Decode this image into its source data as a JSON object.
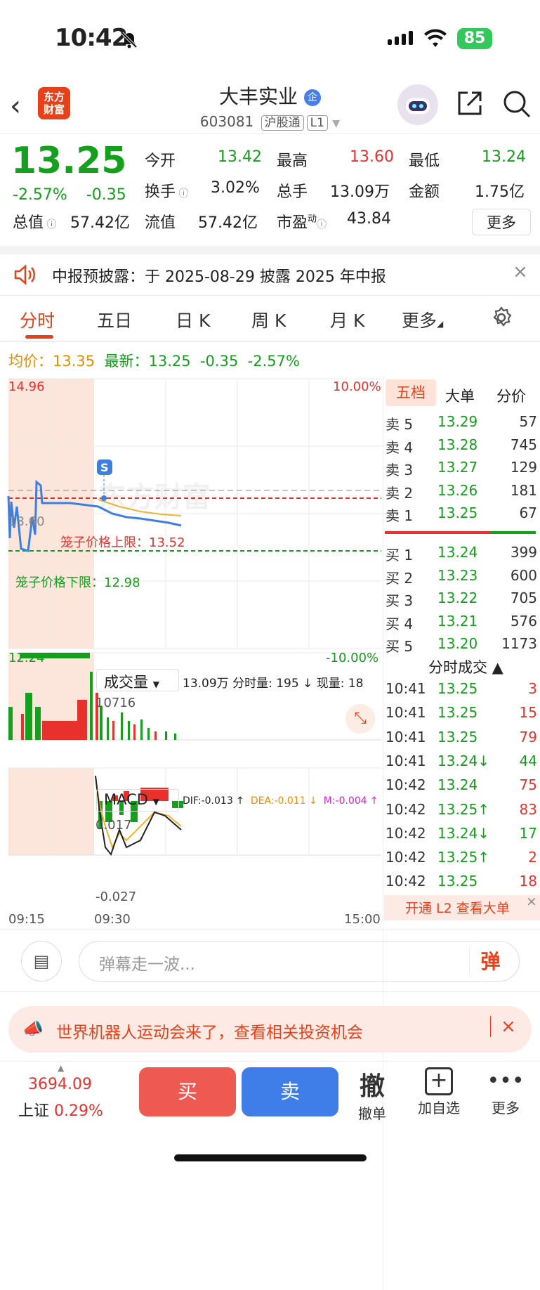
{
  "status": {
    "time": "10:42",
    "battery": "85"
  },
  "header": {
    "logo": "东方\n财富",
    "name": "大丰实业",
    "badge": "企",
    "code": "603081",
    "tag1": "沪股通",
    "tag2": "L1"
  },
  "quote": {
    "price": "13.25",
    "pct": "-2.57%",
    "change": "-0.35",
    "fields": [
      [
        "今开",
        "13.42",
        "最高",
        "13.60",
        "最低",
        "13.24"
      ],
      [
        "换手",
        "3.02%",
        "总手",
        "13.09万",
        "金额",
        "1.75亿"
      ],
      [
        "总值",
        "57.42亿",
        "流值",
        "57.42亿",
        "市盈",
        "43.84"
      ]
    ],
    "dong": "动",
    "more": "更多"
  },
  "notice": "中报预披露：于 2025-08-29 披露 2025 年中报",
  "tabs": [
    "分时",
    "五日",
    "日 K",
    "周 K",
    "月 K",
    "更多"
  ],
  "info": {
    "avg_label": "均价：",
    "avg": "13.35",
    "last_label": "最新：",
    "last": "13.25",
    "chg": "-0.35",
    "pct": "-2.57%"
  },
  "chart": {
    "top": "14.96",
    "bottom": "12.24",
    "top_pct": "10.00%",
    "bottom_pct": "-10.00%",
    "ref": "13.60",
    "upper": "笼子价格上限：13.52",
    "lower": "笼子价格下限：12.98",
    "s": "S",
    "watermark": "东方财富",
    "vol_label": "成交量",
    "vol_info": "13.09万 分时量: 195 ↓ 现量: 18",
    "vol_max": "10716",
    "macd_label": "MACD",
    "dif": "DIF:-0.013 ↑",
    "dea": "DEA:-0.011 ↓",
    "m": "M:-0.004 ↑",
    "macd_top": "0.017",
    "macd_bot": "-0.027",
    "t0": "09:15",
    "t1": "09:30",
    "t2": "15:00"
  },
  "book": {
    "tabs": [
      "五档",
      "大单",
      "分价"
    ],
    "asks": [
      [
        "卖 5",
        "13.29",
        "57"
      ],
      [
        "卖 4",
        "13.28",
        "745"
      ],
      [
        "卖 3",
        "13.27",
        "129"
      ],
      [
        "卖 2",
        "13.26",
        "181"
      ],
      [
        "卖 1",
        "13.25",
        "67"
      ]
    ],
    "bids": [
      [
        "买 1",
        "13.24",
        "399"
      ],
      [
        "买 2",
        "13.23",
        "600"
      ],
      [
        "买 3",
        "13.22",
        "705"
      ],
      [
        "买 4",
        "13.21",
        "576"
      ],
      [
        "买 5",
        "13.20",
        "1173"
      ]
    ],
    "trades_title": "分时成交 ▲",
    "trades": [
      [
        "10:41",
        "13.25",
        "3"
      ],
      [
        "10:41",
        "13.25",
        "15"
      ],
      [
        "10:41",
        "13.25",
        "79"
      ],
      [
        "10:41",
        "13.24↓",
        "44"
      ],
      [
        "10:42",
        "13.24",
        "75"
      ],
      [
        "10:42",
        "13.25↑",
        "83"
      ],
      [
        "10:42",
        "13.24↓",
        "17"
      ],
      [
        "10:42",
        "13.25↑",
        "2"
      ],
      [
        "10:42",
        "13.25",
        "18"
      ]
    ],
    "l2": "开通 L2 查看大单"
  },
  "danmu": {
    "placeholder": "弹幕走一波...",
    "btn": "弹"
  },
  "ad": "世界机器人运动会来了，查看相关投资机会",
  "bottom": {
    "index": "3694.09",
    "index_name": "上证",
    "index_pct": "0.29%",
    "buy": "买",
    "sell": "卖",
    "cancel": "撤单",
    "cancel_glyph": "撤",
    "add": "加自选",
    "more": "更多"
  }
}
